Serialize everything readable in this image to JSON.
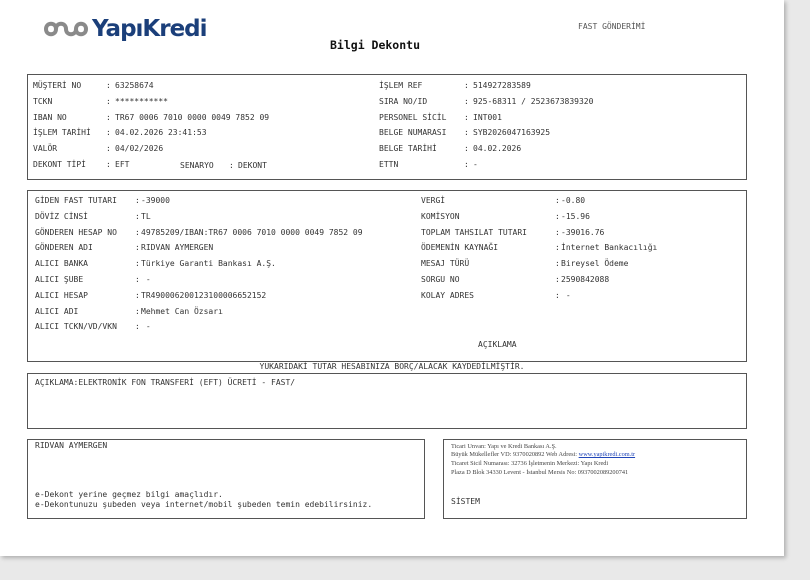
{
  "header": {
    "brand": "YapıKredi",
    "title": "Bilgi Dekontu",
    "transfer_type": "FAST GÖNDERİMİ"
  },
  "customer": {
    "left": [
      {
        "label": "MÜŞTERİ NO",
        "value": "63258674"
      },
      {
        "label": "TCKN",
        "value": "***********"
      },
      {
        "label": "IBAN NO",
        "value": "TR67 0006 7010 0000 0049 7852 09"
      },
      {
        "label": "İŞLEM TARİHİ",
        "value": "04.02.2026 23:41:53"
      },
      {
        "label": "VALÖR",
        "value": "04/02/2026"
      },
      {
        "label": "DEKONT TİPİ",
        "value": "EFT"
      }
    ],
    "scenario_label": "SENARYO",
    "scenario_value": "DEKONT",
    "right": [
      {
        "label": "İŞLEM REF",
        "value": "514927283589"
      },
      {
        "label": "SIRA NO/ID",
        "value": "925-68311 / 2523673839320"
      },
      {
        "label": "PERSONEL SİCİL",
        "value": "INT001"
      },
      {
        "label": "BELGE NUMARASI",
        "value": "SYB2026047163925"
      },
      {
        "label": "BELGE TARİHİ",
        "value": "04.02.2026"
      },
      {
        "label": "ETTN",
        "value": "-"
      }
    ]
  },
  "transfer": {
    "left": [
      {
        "label": "GİDEN FAST TUTARI",
        "value": "-39000"
      },
      {
        "label": "DÖVİZ CİNSİ",
        "value": "TL"
      },
      {
        "label": "GÖNDEREN HESAP NO",
        "value": "49785209/IBAN:TR67 0006 7010 0000 0049 7852 09"
      },
      {
        "label": "GÖNDEREN ADI",
        "value": "RIDVAN AYMERGEN"
      },
      {
        "label": "ALICI BANKA",
        "value": "Türkiye Garanti Bankası A.Ş."
      },
      {
        "label": "ALICI ŞUBE",
        "value": " -"
      },
      {
        "label": "ALICI HESAP",
        "value": "TR490006200123100006652152"
      },
      {
        "label": "ALICI ADI",
        "value": "Mehmet Can Özsarı"
      },
      {
        "label": "ALICI TCKN/VD/VKN",
        "value": " -"
      }
    ],
    "right": [
      {
        "label": "VERGİ",
        "value": "-0.80"
      },
      {
        "label": "KOMİSYON",
        "value": "-15.96"
      },
      {
        "label": "TOPLAM TAHSILAT TUTARI",
        "value": "-39016.76"
      },
      {
        "label": "ÖDEMENİN KAYNAĞI",
        "value": "İnternet Bankacılığı"
      },
      {
        "label": "MESAJ TÜRÜ",
        "value": "Bireysel Ödeme"
      },
      {
        "label": "SORGU NO",
        "value": "2590842088"
      },
      {
        "label": "KOLAY ADRES",
        "value": " -"
      }
    ],
    "description_heading": "AÇIKLAMA"
  },
  "notice": "YUKARIDAKİ TUTAR HESABINIZA BORÇ/ALACAK KAYDEDİLMİŞTİR.",
  "description": "AÇIKLAMA:ELEKTRONİK FON TRANSFERİ (EFT) ÜCRETİ - FAST/",
  "footer": {
    "name": "RIDVAN AYMERGEN",
    "disclaimer_1": "e-Dekont yerine geçmez bilgi amaçlıdır.",
    "disclaimer_2": "e-Dekontunuzu şubeden veya internet/mobil şubeden temin edebilirsiniz.",
    "company_line_1": "Ticari Unvan: Yapı ve Kredi Bankası A.Ş.",
    "company_line_2a": "Büyük Mükellefler VD: 9370020892 Web Adresi: ",
    "company_link": "www.yapikredi.com.tr",
    "company_line_3": "Ticaret Sicil Numarası: 32736 İşletmenin Merkezi: Yapı Kredi",
    "company_line_4": "Plaza D Blok 34330 Levent - İstanbul Mersis No: 0937002089200741",
    "system": "SİSTEM"
  },
  "colors": {
    "brand": "#1b3f7a",
    "logo_mark": "#8a8a8a"
  }
}
